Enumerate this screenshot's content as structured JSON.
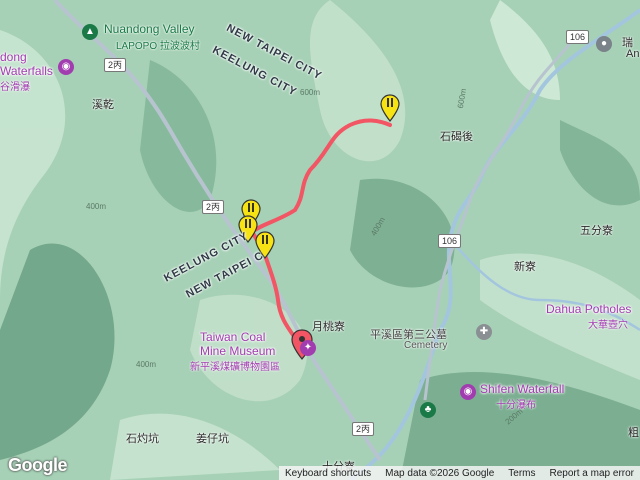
{
  "labels": {
    "nuandong_en": "Nuandong Valley",
    "nuandong_zh": "LAPOPO 拉波波村",
    "waterfalls_a": "dong",
    "waterfalls_b": "Waterfalls",
    "waterfalls_zh": "谷滑瀑",
    "xiqian": "溪乾",
    "new_taipei_top": "NEW TAIPEI CITY",
    "keelung_top": "KEELUNG CITY",
    "keelung_mid": "KEELUNG CITY",
    "new_taipei_mid": "NEW TAIPEI C",
    "shiwanhou": "石碣後",
    "wufenliao": "五分寮",
    "xinliao": "新寮",
    "yuetaoliao": "月桃寮",
    "coal_en_1": "Taiwan Coal",
    "coal_en_2": "Mine Museum",
    "coal_zh": "新平溪煤礦博物園區",
    "cemetery_zh": "平溪區第三公墓",
    "cemetery_en": "Cemetery",
    "dahua_en": "Dahua Potholes",
    "dahua_zh": "大華壺穴",
    "shifen_en": "Shifen Waterfall",
    "shifen_zh": "十分瀑布",
    "shizhuokeng": "石灼坑",
    "jiangzaikeng": "姜仔坑",
    "shifenliao": "十分寮",
    "rui_zh": "瑞",
    "rui_en": "An",
    "bin": "粗"
  },
  "road_shields": {
    "r2c_top": "2丙",
    "r2c_mid": "2丙",
    "r2c_bot": "2丙",
    "r106_top": "106",
    "r106_mid": "106"
  },
  "contours": {
    "c400a": "400m",
    "c400b": "400m",
    "c400c": "400m",
    "c600a": "600m",
    "c600b": "600m",
    "c200": "200m"
  },
  "attribution": {
    "shortcuts": "Keyboard shortcuts",
    "mapdata": "Map data ©2026 Google",
    "terms": "Terms",
    "report": "Report a map error"
  },
  "logo": "Google",
  "colors": {
    "route": "#f25563",
    "marker": "#f7e214",
    "poi_purple": "#a23db0",
    "poi_green": "#1a7a47",
    "river": "#a3c6de",
    "road": "#b7c4cf"
  },
  "markers": [
    {
      "name": "waypoint-marker-peak",
      "icon": "map-pin-icon"
    },
    {
      "name": "waypoint-marker-a",
      "icon": "map-pin-icon"
    },
    {
      "name": "waypoint-marker-b",
      "icon": "map-pin-icon"
    },
    {
      "name": "waypoint-marker-c",
      "icon": "map-pin-icon"
    },
    {
      "name": "start-marker",
      "icon": "map-pin-icon"
    }
  ]
}
